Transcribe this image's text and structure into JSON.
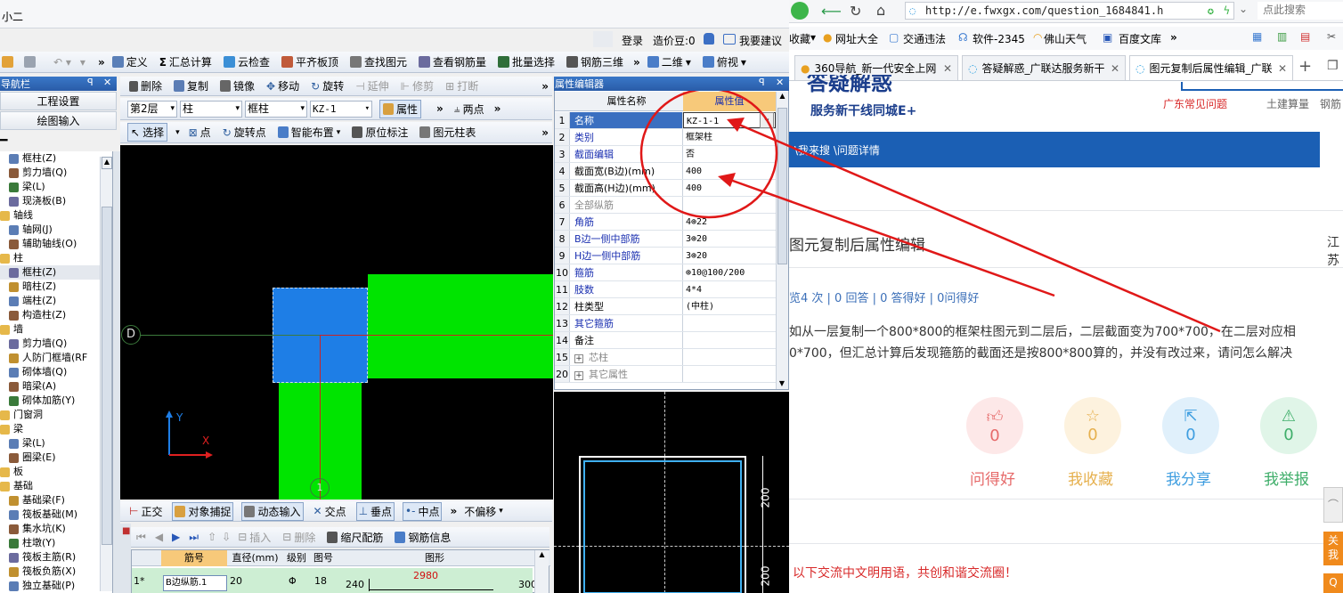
{
  "ide": {
    "title_line": "小二",
    "top_login": "登录",
    "top_credit": "造价豆:0",
    "top_suggest": "我要建议",
    "toolbar1": [
      "定义",
      "汇总计算",
      "云检查",
      "平齐板顶",
      "查找图元",
      "查看钢筋量",
      "批量选择",
      "钢筋三维",
      "二维",
      "俯视"
    ],
    "nav_title": "导航栏",
    "nav_buttons": [
      "工程设置",
      "绘图输入"
    ],
    "edit_toolbar": [
      "删除",
      "复制",
      "镜像",
      "移动",
      "旋转",
      "延伸",
      "修剪",
      "打断"
    ],
    "layer_bar": {
      "floor": "第2层",
      "type": "柱",
      "subtype": "框柱",
      "name": "KZ-1",
      "attr_btn": "属性",
      "two_point": "两点"
    },
    "draw_bar": [
      "选择",
      "点",
      "旋转点",
      "智能布置",
      "原位标注",
      "图元柱表"
    ],
    "tree": [
      {
        "label": "框柱(Z)",
        "indent": 1
      },
      {
        "label": "剪力墙(Q)",
        "indent": 1
      },
      {
        "label": "梁(L)",
        "indent": 1
      },
      {
        "label": "现浇板(B)",
        "indent": 1
      },
      {
        "label": "轴线",
        "indent": 0
      },
      {
        "label": "轴网(J)",
        "indent": 1
      },
      {
        "label": "辅助轴线(O)",
        "indent": 1
      },
      {
        "label": "柱",
        "indent": 0
      },
      {
        "label": "框柱(Z)",
        "indent": 1
      },
      {
        "label": "暗柱(Z)",
        "indent": 1
      },
      {
        "label": "端柱(Z)",
        "indent": 1
      },
      {
        "label": "构造柱(Z)",
        "indent": 1
      },
      {
        "label": "墙",
        "indent": 0
      },
      {
        "label": "剪力墙(Q)",
        "indent": 1
      },
      {
        "label": "人防门框墙(RF",
        "indent": 1
      },
      {
        "label": "砌体墙(Q)",
        "indent": 1
      },
      {
        "label": "暗梁(A)",
        "indent": 1
      },
      {
        "label": "砌体加筋(Y)",
        "indent": 1
      },
      {
        "label": "门窗洞",
        "indent": 0
      },
      {
        "label": "梁",
        "indent": 0
      },
      {
        "label": "梁(L)",
        "indent": 1
      },
      {
        "label": "圈梁(E)",
        "indent": 1
      },
      {
        "label": "板",
        "indent": 0
      },
      {
        "label": "基础",
        "indent": 0
      },
      {
        "label": "基础梁(F)",
        "indent": 1
      },
      {
        "label": "筏板基础(M)",
        "indent": 1
      },
      {
        "label": "集水坑(K)",
        "indent": 1
      },
      {
        "label": "柱墩(Y)",
        "indent": 1
      },
      {
        "label": "筏板主筋(R)",
        "indent": 1
      },
      {
        "label": "筏板负筋(X)",
        "indent": 1
      },
      {
        "label": "独立基础(P)",
        "indent": 1
      }
    ],
    "axis_label": "D",
    "axis_label_bottom": "1",
    "prop_title": "属性编辑器",
    "prop_headers": [
      "属性名称",
      "属性值"
    ],
    "props": [
      {
        "n": "1",
        "name": "名称",
        "val": "KZ-1-1",
        "style": "blue",
        "selected": true
      },
      {
        "n": "2",
        "name": "类别",
        "val": "框架柱",
        "style": "blue"
      },
      {
        "n": "3",
        "name": "截面编辑",
        "val": "否",
        "style": "blue"
      },
      {
        "n": "4",
        "name": "截面宽(B边)(mm)",
        "val": "400",
        "style": "black"
      },
      {
        "n": "5",
        "name": "截面高(H边)(mm)",
        "val": "400",
        "style": "black"
      },
      {
        "n": "6",
        "name": "全部纵筋",
        "val": "",
        "style": "gray"
      },
      {
        "n": "7",
        "name": "角筋",
        "val": "4⊕22",
        "style": "blue"
      },
      {
        "n": "8",
        "name": "B边一侧中部筋",
        "val": "3⊕20",
        "style": "blue"
      },
      {
        "n": "9",
        "name": "H边一侧中部筋",
        "val": "3⊕20",
        "style": "blue"
      },
      {
        "n": "10",
        "name": "箍筋",
        "val": "⊕10@100/200",
        "style": "blue"
      },
      {
        "n": "11",
        "name": "肢数",
        "val": "4*4",
        "style": "blue"
      },
      {
        "n": "12",
        "name": "柱类型",
        "val": "(中柱)",
        "style": "black"
      },
      {
        "n": "13",
        "name": "其它箍筋",
        "val": "",
        "style": "blue"
      },
      {
        "n": "14",
        "name": "备注",
        "val": "",
        "style": "black"
      },
      {
        "n": "15",
        "name": "芯柱",
        "val": "",
        "style": "gray",
        "expand": true
      },
      {
        "n": "20",
        "name": "其它属性",
        "val": "",
        "style": "gray",
        "expand": true
      }
    ],
    "snap_bar": [
      "正交",
      "对象捕捉",
      "动态输入",
      "交点",
      "垂点",
      "中点",
      "不偏移"
    ],
    "grid_bar": [
      "插入",
      "删除",
      "缩尺配筋",
      "钢筋信息"
    ],
    "grid_headers": [
      "筋号",
      "直径(mm)",
      "级别",
      "图号",
      "图形"
    ],
    "grid_row": {
      "idx": "1*",
      "name": "B边纵筋.1",
      "dia": "20",
      "grade": "Φ",
      "fig": "18",
      "left": "240",
      "len": "2980",
      "right": "300"
    },
    "section_dims": [
      "200",
      "200"
    ]
  },
  "browser": {
    "url": "http://e.fwxgx.com/question_1684841.h",
    "search_placeholder": "点此搜索",
    "bookmarks": [
      "收藏",
      "网址大全",
      "交通违法",
      "软件-2345",
      "佛山天气",
      "百度文库"
    ],
    "tabs": [
      "360导航_新一代安全上网",
      "答疑解惑_广联达服务新干",
      "图元复制后属性编辑_广联"
    ],
    "site_logo": "答疑解惑",
    "site_slogan": "服务新干线同城E+",
    "site_links": [
      "广东常见问题",
      "土建算量",
      "钢筋"
    ],
    "breadcrumb": "\\我来搜 \\问题详情",
    "question_title": "图元复制后属性编辑",
    "title_right": "江苏",
    "stats": "览4 次 | 0 回答 | 0 答得好 | 0问得好",
    "body_line1": "如从一层复制一个800*800的框架柱图元到二层后，二层截面变为700*700，在二层对应相",
    "body_line2": "0*700，但汇总计算后发现箍筋的截面还是按800*800算的，并没有改过来，请问怎么解决",
    "actions": [
      {
        "label": "问得好",
        "count": "0",
        "color": "#e66a6a",
        "bg": "#fde8e8",
        "icon": "thumb-icon"
      },
      {
        "label": "我收藏",
        "count": "0",
        "color": "#e6b04e",
        "bg": "#fdf2de",
        "icon": "star-icon"
      },
      {
        "label": "我分享",
        "count": "0",
        "color": "#3f9ee0",
        "bg": "#e0f0fb",
        "icon": "share-icon"
      },
      {
        "label": "我举报",
        "count": "0",
        "color": "#3fae6a",
        "bg": "#e0f5e8",
        "icon": "warning-icon"
      }
    ],
    "notice": "以下交流中文明用语，共创和谐交流圈！",
    "side_float": [
      "关",
      "我",
      "Q"
    ]
  }
}
